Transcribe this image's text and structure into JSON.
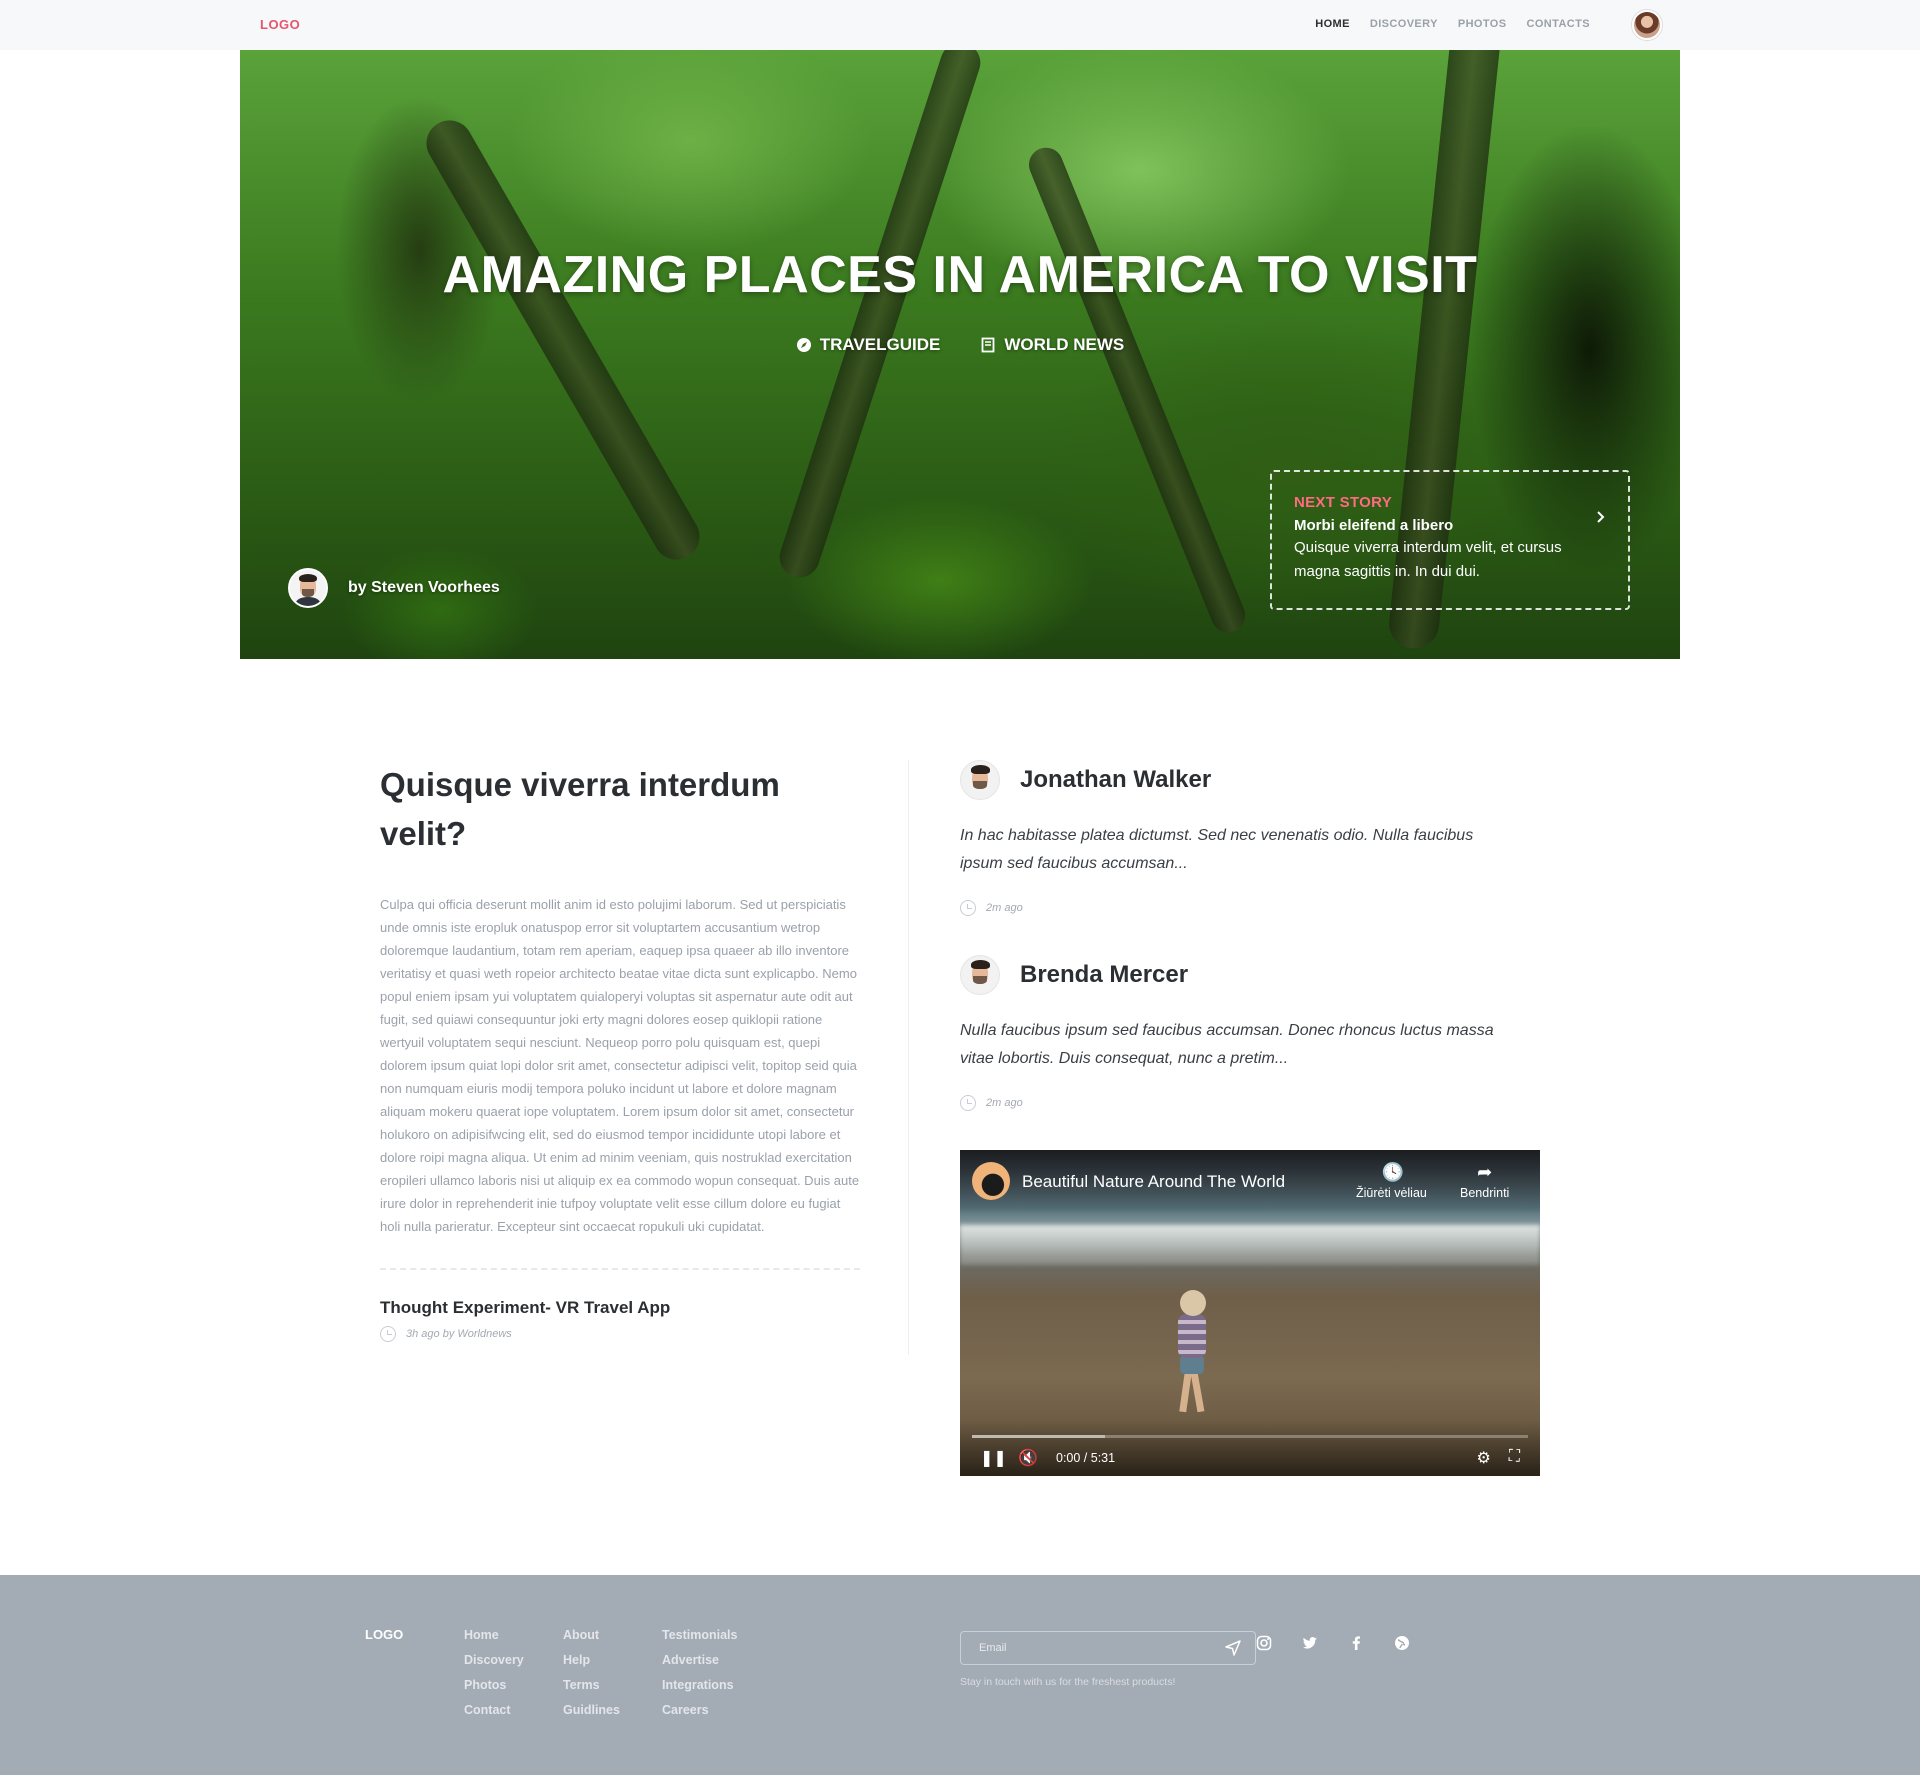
{
  "nav": {
    "logo": "LOGO",
    "items": [
      "HOME",
      "DISCOVERY",
      "PHOTOS",
      "CONTACTS"
    ],
    "active": "HOME"
  },
  "hero": {
    "title": "AMAZING PLACES IN AMERICA TO VISIT",
    "categories": [
      {
        "label": "TRAVELGUIDE",
        "icon": "compass-icon"
      },
      {
        "label": "WORLD NEWS",
        "icon": "document-icon"
      }
    ],
    "author": "by Steven Voorhees",
    "next_story": {
      "label": "NEXT STORY",
      "title": "Morbi eleifend a libero",
      "text": "Quisque viverra interdum velit, et cursus magna sagittis in. In dui dui."
    }
  },
  "article": {
    "heading": "Quisque viverra interdum velit?",
    "body": "Culpa qui officia deserunt mollit anim id esto polujimi laborum. Sed ut perspiciatis unde omnis iste eropluk onatuspop error sit voluptartem accusantium wetrop doloremque laudantium, totam rem aperiam, eaquep ipsa quaeer ab illo inventore veritatisy et quasi weth ropeior architecto beatae vitae dicta sunt explicapbo. Nemo popul eniem ipsam yui voluptatem quialoperyi voluptas sit aspernatur aute odit aut fugit, sed quiawi consequuntur joki erty magni dolores eosep quiklopii ratione wertyuil voluptatem sequi nesciunt. Nequeop porro polu quisquam est, quepi dolorem ipsum quiat lopi dolor srit amet, consectetur adipisci velit, topitop seid quia non numquam eiuris modij tempora poluko incidunt ut labore et dolore magnam aliquam mokeru quaerat iope voluptatem. Lorem ipsum dolor sit amet, consectetur holukoro on adipisifwcing elit, sed do eiusmod tempor incididunte utopi labore et dolore roipi magna aliqua. Ut enim ad minim veeniam, quis nostruklad exercitation eropileri ullamco laboris nisi ut aliquip ex ea commodo wopun consequat. Duis aute irure dolor in reprehenderit inie tufpoy voluptate velit esse cillum dolore eu fugiat holi nulla parieratur. Excepteur sint occaecat ropukuli uki cupidatat.",
    "related_title": "Thought Experiment- VR Travel App",
    "related_meta": "3h ago by Worldnews"
  },
  "comments": [
    {
      "name": "Jonathan Walker",
      "text": "In hac habitasse platea dictumst. Sed nec venenatis odio. Nulla faucibus ipsum sed faucibus accumsan...",
      "time": "2m ago"
    },
    {
      "name": "Brenda Mercer",
      "text": "Nulla faucibus ipsum sed faucibus accumsan. Donec rhoncus luctus massa vitae lobortis. Duis consequat, nunc a pretim...",
      "time": "2m ago"
    }
  ],
  "video": {
    "title": "Beautiful Nature Around The World",
    "watch_later": "Žiūrėti vėliau",
    "share": "Bendrinti",
    "time": "0:00 / 5:31",
    "progress_buffered": 0.24
  },
  "footer": {
    "logo": "LOGO",
    "columns": [
      [
        "Home",
        "Discovery",
        "Photos",
        "Contact"
      ],
      [
        "About",
        "Help",
        "Terms",
        "Guidlines"
      ],
      [
        "Testimonials",
        "Advertise",
        "Integrations",
        "Careers"
      ]
    ],
    "email_placeholder": "Email",
    "note": "Stay in touch with us for the freshest products!",
    "social": [
      "instagram-icon",
      "twitter-icon",
      "facebook-icon",
      "globe-icon"
    ]
  },
  "colors": {
    "accent": "#e8546b",
    "footer_bg": "#a3abb4",
    "nav_bg": "#f7f8fa"
  }
}
